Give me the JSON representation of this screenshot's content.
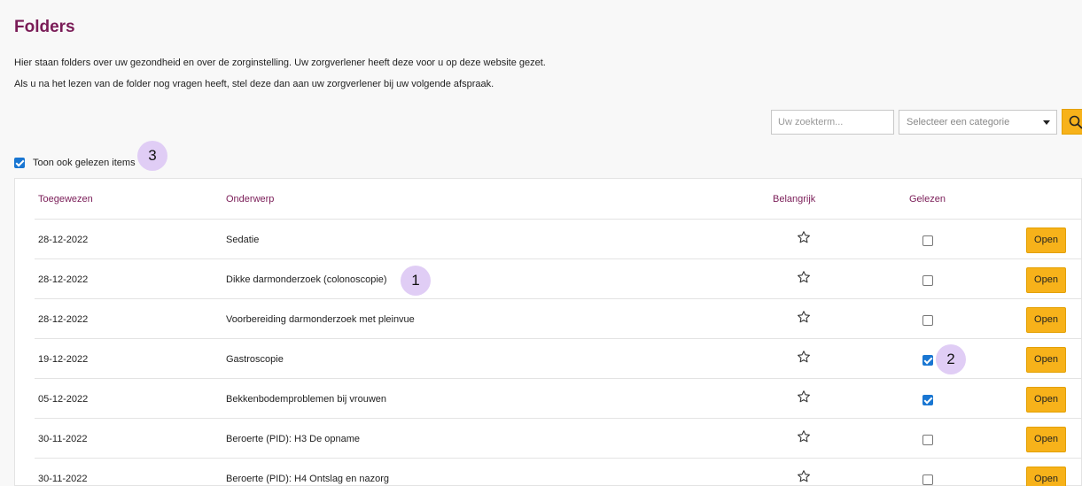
{
  "page": {
    "title": "Folders",
    "intro_line1": "Hier staan folders over uw gezondheid en over de zorginstelling. Uw zorgverlener heeft deze voor u op deze website gezet.",
    "intro_line2": "Als u na het lezen van de folder nog vragen heeft, stel deze dan aan uw zorgverlener bij uw volgende afspraak."
  },
  "search": {
    "placeholder": "Uw zoekterm...",
    "category_placeholder": "Selecteer een categorie"
  },
  "filter": {
    "show_read_label": "Toon ook gelezen items",
    "show_read_checked": true
  },
  "badges": [
    "1",
    "2",
    "3"
  ],
  "table": {
    "headers": {
      "assigned": "Toegewezen",
      "subject": "Onderwerp",
      "important": "Belangrijk",
      "read": "Gelezen"
    },
    "open_label": "Open",
    "rows": [
      {
        "date": "28-12-2022",
        "subject": "Sedatie",
        "read": false
      },
      {
        "date": "28-12-2022",
        "subject": "Dikke darmonderzoek (colonoscopie)",
        "read": false
      },
      {
        "date": "28-12-2022",
        "subject": "Voorbereiding darmonderzoek met pleinvue",
        "read": false
      },
      {
        "date": "19-12-2022",
        "subject": "Gastroscopie",
        "read": true
      },
      {
        "date": "05-12-2022",
        "subject": "Bekkenbodemproblemen bij vrouwen",
        "read": true
      },
      {
        "date": "30-11-2022",
        "subject": "Beroerte (PID): H3 De opname",
        "read": false
      },
      {
        "date": "30-11-2022",
        "subject": "Beroerte (PID): H4 Ontslag en nazorg",
        "read": false
      }
    ]
  },
  "colors": {
    "brand": "#7a1c57",
    "accent": "#f7b21a",
    "checkbox": "#1976d2",
    "badge": "#e0cdf5"
  },
  "icons": {
    "search": "search-icon",
    "star": "star-outline-icon",
    "dropdown": "chevron-down-icon"
  }
}
